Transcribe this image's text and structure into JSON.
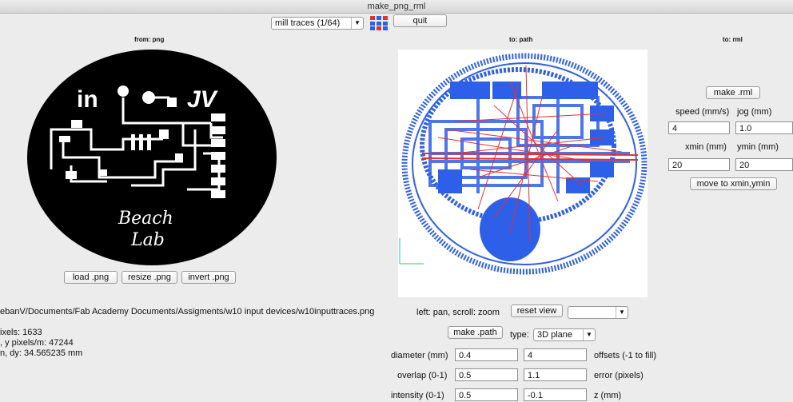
{
  "window": {
    "title": "make_png_rml"
  },
  "top": {
    "process_selected": "mill traces (1/64)",
    "quit_label": "quit"
  },
  "headers": {
    "from": "from: png",
    "to_path": "to: path",
    "to_rml": "to: rml"
  },
  "png_panel": {
    "logo_text_left": "in",
    "logo_text_right": "JV",
    "logo_script_line1": "Beach",
    "logo_script_line2": "Lab",
    "load_label": "load .png",
    "resize_label": "resize .png",
    "invert_label": "invert .png",
    "file_path": "ebanV/Documents/Fab Academy Documents/Assigments/w10 input devices/w10inputtraces.png",
    "info_line1": "ixels: 1633",
    "info_line2": ", y pixels/m: 47244",
    "info_line3": "n, dy: 34.565235 mm"
  },
  "path_panel": {
    "hint": "left: pan, scroll: zoom",
    "reset_view_label": "reset view",
    "view_select_value": "",
    "make_path_label": "make .path",
    "type_label": "type:",
    "type_value": "3D plane",
    "params": [
      {
        "label": "diameter (mm)",
        "value1": "0.4",
        "value2": "4",
        "label2": "offsets (-1 to fill)"
      },
      {
        "label": "overlap (0-1)",
        "value1": "0.5",
        "value2": "1.1",
        "label2": "error (pixels)"
      },
      {
        "label": "intensity (0-1)",
        "value1": "0.5",
        "value2": "-0.1",
        "label2": "z (mm)"
      }
    ]
  },
  "rml_panel": {
    "make_rml_label": "make .rml",
    "speed_label": "speed (mm/s)",
    "speed_value": "4",
    "jog_label": "jog (mm)",
    "jog_value": "1.0",
    "xmin_label": "xmin (mm)",
    "xmin_value": "20",
    "ymin_label": "ymin (mm)",
    "ymin_value": "20",
    "move_label": "move to xmin,ymin"
  },
  "colors": {
    "toolpath": "#2e5fe8",
    "rapid": "#e53030",
    "board": "#000000",
    "traces": "#ffffff"
  }
}
